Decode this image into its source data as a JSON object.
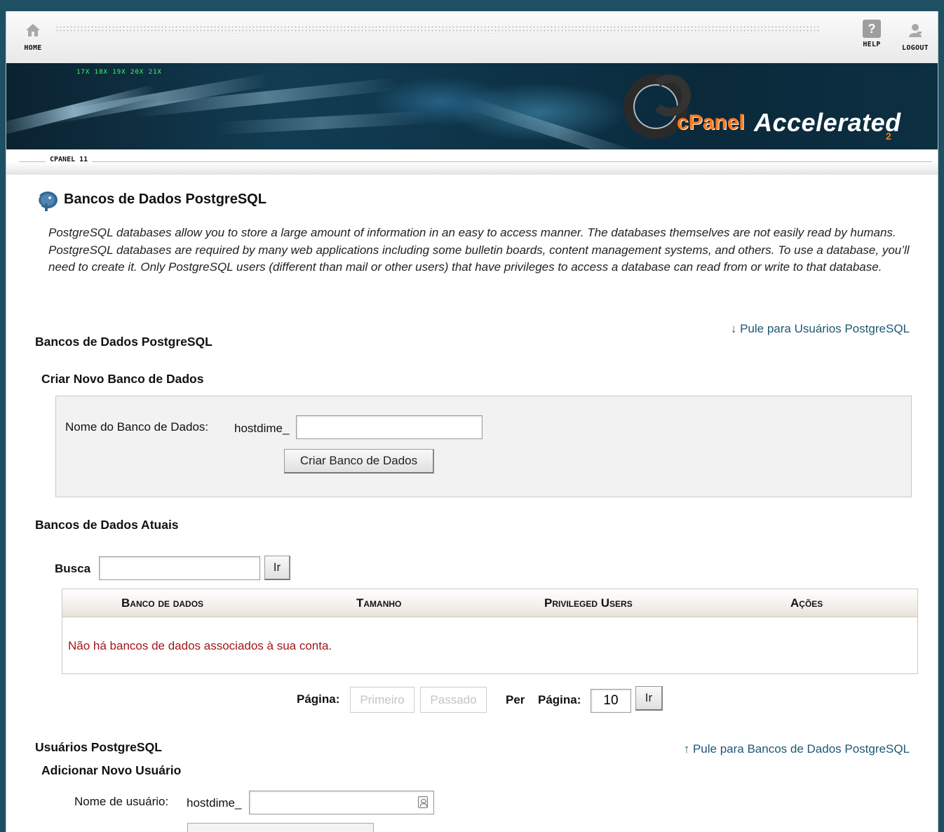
{
  "nav": {
    "home_label": "HOME",
    "help_label": "HELP",
    "logout_label": "LOGOUT",
    "help_glyph": "?"
  },
  "banner": {
    "led_text": "17X   18X   19X   20X   21X",
    "brand_cpanel": "cPanel",
    "brand_accelerated": "Accelerated",
    "brand_version": "2"
  },
  "breadcrumb": {
    "label": "CPANEL 11"
  },
  "page": {
    "title": "Bancos de Dados PostgreSQL",
    "description": "PostgreSQL databases allow you to store a large amount of information in an easy to access manner. The databases themselves are not easily read by humans. PostgreSQL databases are required by many web applications including some bulletin boards, content management systems, and others. To use a database, you’ll need to create it. Only PostgreSQL users (different than mail or other users) that have privileges to access a database can read from or write to that database."
  },
  "databases_section": {
    "heading": "Bancos de Dados PostgreSQL",
    "jump_arrow": "↓",
    "jump_link": "Pule para Usuários PostgreSQL"
  },
  "create_db": {
    "heading": "Criar Novo Banco de Dados",
    "name_label": "Nome do Banco de Dados:",
    "prefix": "hostdime_",
    "name_value": "",
    "submit_label": "Criar Banco de Dados"
  },
  "current_dbs": {
    "heading": "Bancos de Dados Atuais",
    "search_label": "Busca",
    "search_value": "",
    "search_button": "Ir",
    "columns": [
      "Banco de dados",
      "Tamanho",
      "Privileged Users",
      "Ações"
    ],
    "rows": [],
    "empty_message": "Não há bancos de dados associados à sua conta."
  },
  "pagination": {
    "page_label": "Página:",
    "first_button": "Primeiro",
    "last_button": "Passado",
    "per_label": "Per",
    "per_page_label": "Página:",
    "per_page_value": "10",
    "go_button": "Ir"
  },
  "users_section": {
    "heading": "Usuários PostgreSQL",
    "jump_arrow": "↑",
    "jump_link": "Pule para Bancos de Dados PostgreSQL",
    "add_heading": "Adicionar Novo Usuário",
    "username_label": "Nome de usuário:",
    "prefix": "hostdime_",
    "username_value": ""
  }
}
